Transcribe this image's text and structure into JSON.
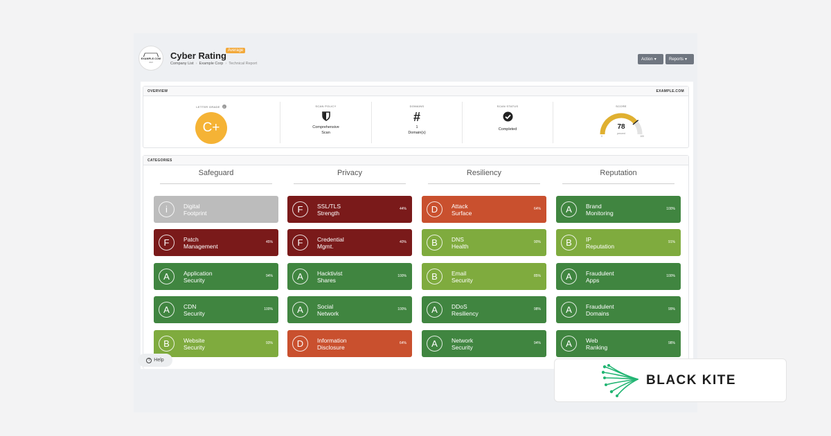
{
  "header": {
    "logo_text": "EXAMPLE.COM",
    "logo_sub": "2024",
    "title": "Cyber Rating",
    "badge": "Average",
    "breadcrumbs": [
      "Company List",
      "Example Corp",
      "Technical Report"
    ],
    "action_label": "Action",
    "reports_label": "Reports"
  },
  "overview": {
    "heading": "OVERVIEW",
    "domain": "EXAMPLE.COM",
    "letter_grade_label": "LETTER GRADE",
    "letter_grade": "C+",
    "scan_policy_label": "SCAN POLICY",
    "scan_policy_line1": "Comprehensive",
    "scan_policy_line2": "Scan",
    "domains_label": "DOMAINS",
    "domains_count": "1",
    "domains_unit": "Domain(s)",
    "scan_status_label": "SCAN STATUS",
    "scan_status": "Completed",
    "score_label": "SCORE",
    "score": 78,
    "score_unit": "percent",
    "score_min": "0",
    "score_max": "100"
  },
  "categories": {
    "heading": "CATEGORIES",
    "columns": [
      {
        "title": "Safeguard",
        "items": [
          {
            "grade": "i",
            "name": "Digital\nFootprint",
            "percent": "",
            "status": "info"
          },
          {
            "grade": "F",
            "name": "Patch\nManagement",
            "percent": "45%",
            "status": "bad"
          },
          {
            "grade": "A",
            "name": "Application\nSecurity",
            "percent": "94%",
            "status": "good"
          },
          {
            "grade": "A",
            "name": "CDN\nSecurity",
            "percent": "100%",
            "status": "good"
          },
          {
            "grade": "B",
            "name": "Website\nSecurity",
            "percent": "93%",
            "status": "ok"
          }
        ]
      },
      {
        "title": "Privacy",
        "items": [
          {
            "grade": "F",
            "name": "SSL/TLS\nStrength",
            "percent": "44%",
            "status": "bad"
          },
          {
            "grade": "F",
            "name": "Credential\nMgmt.",
            "percent": "40%",
            "status": "bad"
          },
          {
            "grade": "A",
            "name": "Hacktivist\nShares",
            "percent": "100%",
            "status": "good"
          },
          {
            "grade": "A",
            "name": "Social\nNetwork",
            "percent": "100%",
            "status": "good"
          },
          {
            "grade": "D",
            "name": "Information\nDisclosure",
            "percent": "64%",
            "status": "warn"
          }
        ]
      },
      {
        "title": "Resiliency",
        "items": [
          {
            "grade": "D",
            "name": "Attack\nSurface",
            "percent": "64%",
            "status": "warn"
          },
          {
            "grade": "B",
            "name": "DNS\nHealth",
            "percent": "90%",
            "status": "ok"
          },
          {
            "grade": "B",
            "name": "Email\nSecurity",
            "percent": "85%",
            "status": "ok"
          },
          {
            "grade": "A",
            "name": "DDoS\nResiliency",
            "percent": "98%",
            "status": "good"
          },
          {
            "grade": "A",
            "name": "Network\nSecurity",
            "percent": "94%",
            "status": "good"
          }
        ]
      },
      {
        "title": "Reputation",
        "items": [
          {
            "grade": "A",
            "name": "Brand\nMonitoring",
            "percent": "100%",
            "status": "good"
          },
          {
            "grade": "B",
            "name": "IP\nReputation",
            "percent": "91%",
            "status": "ok"
          },
          {
            "grade": "A",
            "name": "Fraudulent\nApps",
            "percent": "100%",
            "status": "good"
          },
          {
            "grade": "A",
            "name": "Fraudulent\nDomains",
            "percent": "99%",
            "status": "good"
          },
          {
            "grade": "A",
            "name": "Web\nRanking",
            "percent": "98%",
            "status": "good"
          }
        ]
      }
    ]
  },
  "colors": {
    "info": "#bcbcbc",
    "bad": "#7a1a1a",
    "warn": "#c9502e",
    "ok": "#7fab3e",
    "good": "#408540",
    "accent": "#f5b335"
  },
  "help_label": "Help",
  "brand": "BLACK KITE"
}
